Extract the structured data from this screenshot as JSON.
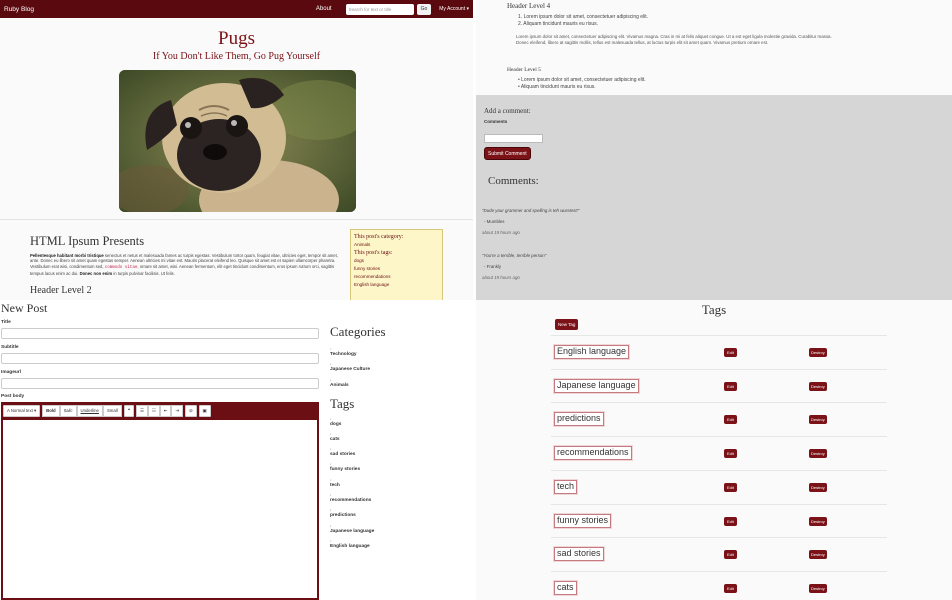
{
  "blog": {
    "brand": "Ruby Blog",
    "nav_about": "About",
    "search_placeholder": "Search for text or title",
    "search_button": "Go",
    "account_menu": "My Account ▾",
    "title": "Pugs",
    "subtitle": "If You Don't Like Them, Go Pug Yourself",
    "ipsum_title": "HTML Ipsum Presents",
    "ipsum_strong": "Pellentesque habitant morbi tristique",
    "ipsum_text_1": " senectus et netus et malesuada fames ac turpis egestas. Vestibulum tortor quam, feugiat vitae, ultricies eget, tempor sit amet, ante. Donec eu libero sit amet quam egestas semper. Aenean ultricies mi vitae est. Mauris placerat eleifend leo. Quisque sit amet est et sapien ullamcorper pharetra. Vestibulum erat wisi, condimentum sed, ",
    "ipsum_code": "commodo vitae",
    "ipsum_text_2": ", ornare sit amet, wisi. Aenean fermentum, elit eget tincidunt condimentum, eros ipsum rutrum orci, sagittis tempus lacus enim ac dui. ",
    "ipsum_strong_2": "Donec non enim",
    "ipsum_text_3": " in turpis pulvinar facilisis. Ut felis.",
    "header2": "Header Level 2",
    "category_label": "This post's category:",
    "category": "Animals",
    "tags_label": "This post's tags:",
    "tags": [
      "dogs",
      "funny stories",
      "recommendations",
      "English language"
    ]
  },
  "comments_page": {
    "header4": "Header Level 4",
    "ol_items": [
      "Lorem ipsum dolor sit amet, consectetuer adipiscing elit.",
      "Aliquam tincidunt mauris eu risus."
    ],
    "paragraph": "Lorem ipsum dolor sit amet, consectetuer adipiscing elit. Vivamus magna. Cras in mi at felis aliquet congue. Ut a est eget ligula molestie gravida. Curabitur massa. Donec eleifend, libero at sagittis mollis, tellus est malesuada tellus, at luctus turpis elit sit amet quam. Vivamus pretium ornare est.",
    "header5": "Header Level 5",
    "ul_items": [
      "Lorem ipsum dolor sit amet, consectetuer adipiscing elit.",
      "Aliquam tincidunt mauris eu risus."
    ],
    "add_comment": "Add a comment:",
    "comments_label": "Comments",
    "submit": "Submit Comment",
    "comments_heading": "Comments:",
    "comments": [
      {
        "text": "\"Dude your grammer and spelling is teh wurstest!\"",
        "author": "- Mumbles",
        "time": "about 19 hours ago"
      },
      {
        "text": "\"You're a terrible, terrible person\"",
        "author": "- Frankly",
        "time": "about 19 hours ago"
      }
    ]
  },
  "new_post": {
    "heading": "New Post",
    "title_label": "Title",
    "subtitle_label": "Subtitle",
    "image_label": "Imageurl",
    "body_label": "Post body",
    "toolbar": {
      "normal_text": "A Normal text ▾",
      "bold": "Bold",
      "italic": "Italic",
      "underline": "Underline",
      "small": "Small",
      "quote": "❝",
      "ul": "☰",
      "ol": "☷",
      "outdent": "⇤",
      "indent": "⇥",
      "link": "⊘",
      "image": "▣"
    },
    "categories_heading": "Categories",
    "categories": [
      "Technology",
      "Japanese Culture",
      "Animals"
    ],
    "tags_heading": "Tags",
    "tags": [
      "dogs",
      "cats",
      "sad stories",
      "funny stories",
      "tech",
      "recommendations",
      "predictions",
      "Japanese language",
      "English language"
    ]
  },
  "tags_admin": {
    "heading": "Tags",
    "new_tag": "New Tag",
    "edit": "Edit",
    "destroy": "Destroy",
    "tags": [
      "English language",
      "Japanese language",
      "predictions",
      "recommendations",
      "tech",
      "funny stories",
      "sad stories",
      "cats"
    ]
  }
}
